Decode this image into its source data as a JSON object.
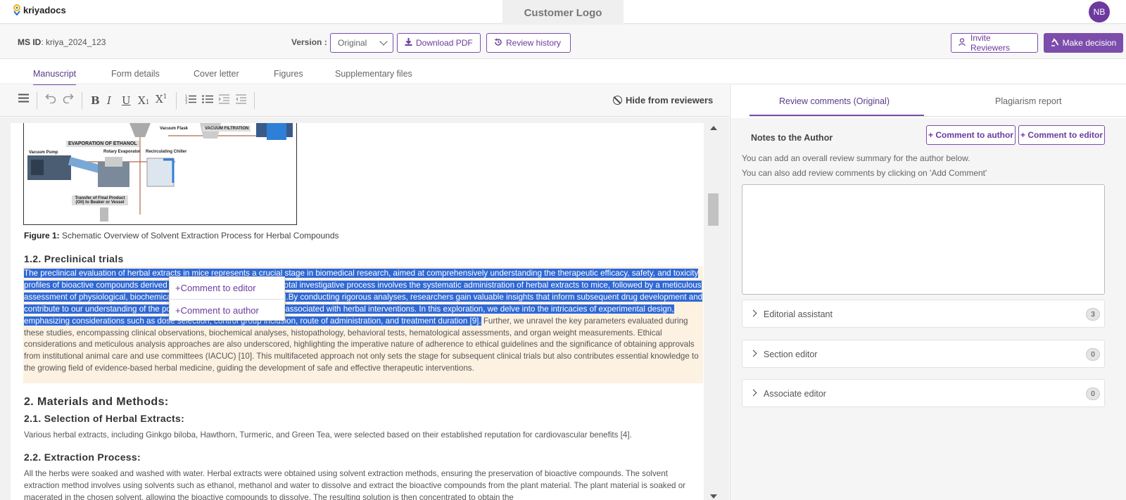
{
  "header": {
    "brand": "kriyadocs",
    "customer_logo": "Customer Logo",
    "avatar_initials": "NB"
  },
  "msbar": {
    "ms_id_label": "MS ID",
    "ms_id_value": ": kriya_2024_123",
    "version_label": "Version :",
    "version_selected": "Original",
    "download_pdf": "Download PDF",
    "review_history": "Review history",
    "invite_reviewers": "Invite Reviewers",
    "make_decision": "Make decision"
  },
  "tabs": [
    "Manuscript",
    "Form details",
    "Cover letter",
    "Figures",
    "Supplementary files"
  ],
  "toolbar": {
    "hide_from_reviewers": "Hide from reviewers"
  },
  "document": {
    "figure_labels": [
      "EVAPORATION OF ETHANOL",
      "Vacuum Flask",
      "VACUUM FILTRATION",
      "Vacuum Pump",
      "Rotary Evaporator",
      "Recirculating Chiller",
      "Transfer of Final Product (Oil) to Beaker or Vessel"
    ],
    "caption_label": "Figure 1:",
    "caption_text": " Schematic Overview of Solvent Extraction Process for Herbal Compounds",
    "heading_1_2": "1.2. Preclinical trials",
    "para_selected": "The preclinical evaluation of herbal extracts in mice represents a crucial stage in biomedical research, aimed at comprehensively understanding the therapeutic efficacy, safety, and toxicity profiles of bioactive compounds derived from botanical sources. This pivotal investigative process involves the systematic administration of herbal extracts to mice, followed by a meticulous assessment of physiological, biochemical, and behavioral parameters [8].By conducting rigorous analyses, researchers gain valuable insights that inform subsequent drug development and contribute to our understanding of the potential health benefits and risks associated with herbal interventions. In this exploration, we delve into the intricacies of experimental design, emphasizing considerations such as dose selection, control group inclusion, route of administration, and treatment duration [9].",
    "para_rest": " Further, we unravel the key parameters evaluated during these studies, encompassing clinical observations, biochemical analyses, histopathology, behavioral tests, hematological assessments, and organ weight measurements. Ethical considerations and meticulous analysis approaches are also underscored, highlighting the imperative nature of adherence to ethical guidelines and the significance of obtaining approvals from institutional animal care and use committees (IACUC) [10]. This multifaceted approach not only sets the stage for subsequent clinical trials but also contributes essential knowledge to the growing field of evidence-based herbal medicine, guiding the development of safe and effective therapeutic interventions.",
    "heading_2": "2. Materials and Methods:",
    "heading_2_1": "2.1. Selection of Herbal Extracts:",
    "para_2_1": "Various herbal extracts, including Ginkgo biloba, Hawthorn, Turmeric, and Green Tea, were selected based on their established reputation for cardiovascular benefits [4].",
    "heading_2_2": "2.2. Extraction Process:",
    "para_2_2": "All the herbs were soaked and washed with water. Herbal extracts were obtained using solvent extraction methods, ensuring the preservation of bioactive compounds. The solvent extraction method involves using solvents such as ethanol, methanol and water to dissolve and extract the bioactive compounds from the plant material. The plant material is soaked or macerated in the chosen solvent, allowing the bioactive compounds to dissolve. The resulting solution is then concentrated to obtain the"
  },
  "popup": {
    "comment_editor": "+Comment to editor",
    "comment_author": "+Comment to author"
  },
  "right_panel": {
    "tabs": [
      "Review comments (Original)",
      "Plagiarism report"
    ],
    "notes_title": "Notes to the Author",
    "btn_comment_author": "+ Comment to author",
    "btn_comment_editor": "+ Comment to editor",
    "hint_1": "You can add an overall review summary for the author below.",
    "hint_2": "You can also add review comments by clicking on 'Add Comment'",
    "accordions": [
      {
        "label": "Editorial assistant",
        "count": "3"
      },
      {
        "label": "Section editor",
        "count": "0"
      },
      {
        "label": "Associate editor",
        "count": "0"
      }
    ]
  },
  "colors": {
    "brand_purple": "#7c4dab",
    "selection_blue": "#2f69d6",
    "highlight_cream": "#fdf1e1"
  }
}
